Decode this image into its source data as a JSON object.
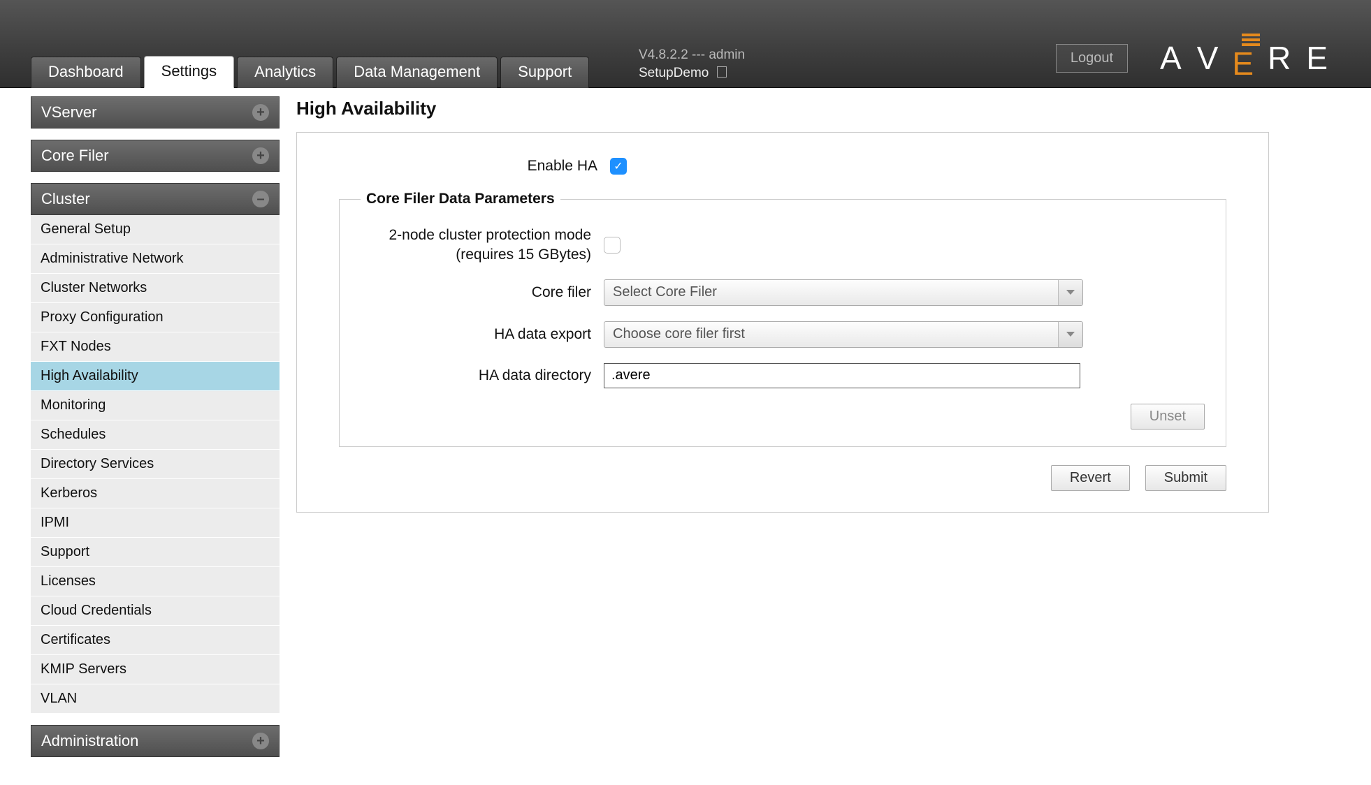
{
  "header": {
    "logout": "Logout",
    "brand_a": "A",
    "brand_v": "V",
    "brand_e": "E",
    "brand_r": "R",
    "brand_e2": "E",
    "info_version": "V4.8.2.2 --- admin",
    "info_name": "SetupDemo",
    "tabs": [
      {
        "label": "Dashboard"
      },
      {
        "label": "Settings",
        "active": true
      },
      {
        "label": "Analytics"
      },
      {
        "label": "Data Management"
      },
      {
        "label": "Support"
      }
    ]
  },
  "sidebar": {
    "vserver": "VServer",
    "corefiler": "Core Filer",
    "cluster": "Cluster",
    "administration": "Administration",
    "cluster_items": [
      "General Setup",
      "Administrative Network",
      "Cluster Networks",
      "Proxy Configuration",
      "FXT Nodes",
      "High Availability",
      "Monitoring",
      "Schedules",
      "Directory Services",
      "Kerberos",
      "IPMI",
      "Support",
      "Licenses",
      "Cloud Credentials",
      "Certificates",
      "KMIP Servers",
      "VLAN"
    ],
    "selected_index": 5
  },
  "main": {
    "title": "High Availability",
    "enable_ha_label": "Enable HA",
    "enable_ha_checked": true,
    "fieldset_legend": "Core Filer Data Parameters",
    "twonode_label": "2-node cluster protection mode (requires 15 GBytes)",
    "twonode_checked": false,
    "corefiler_label": "Core filer",
    "corefiler_selected": "Select Core Filer",
    "haexport_label": "HA data export",
    "haexport_selected": "Choose core filer first",
    "hadir_label": "HA data directory",
    "hadir_value": ".avere",
    "unset_btn": "Unset",
    "revert_btn": "Revert",
    "submit_btn": "Submit"
  }
}
